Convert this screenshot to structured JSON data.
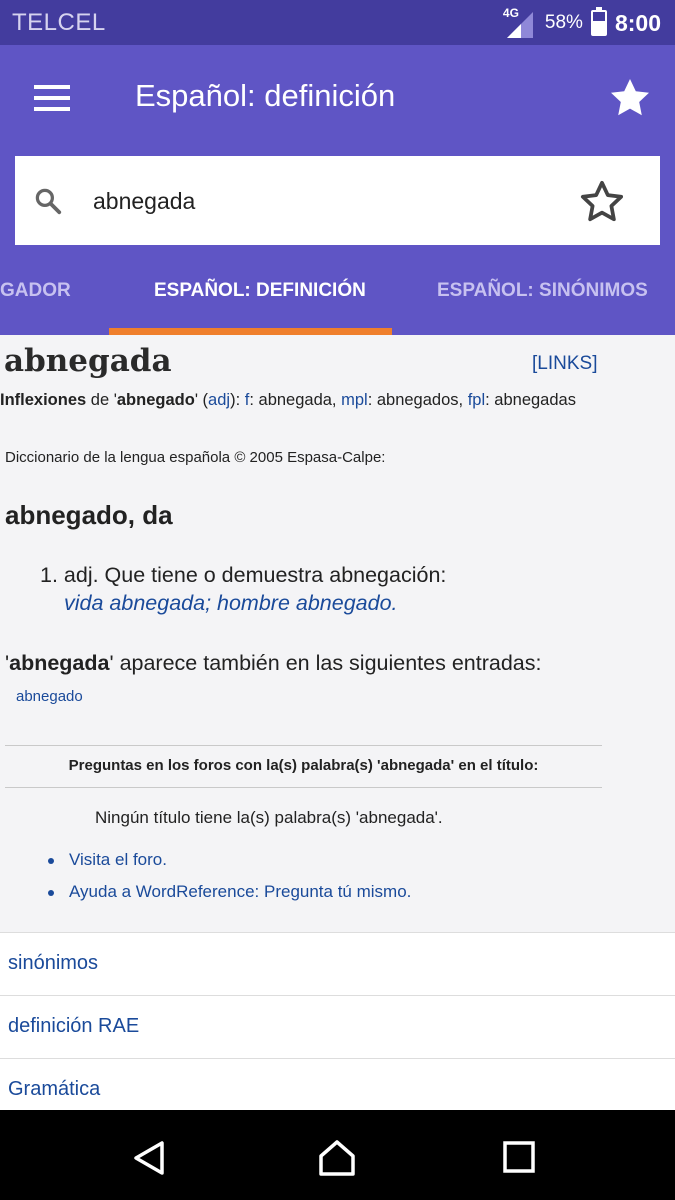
{
  "status_bar": {
    "carrier": "TELCEL",
    "network": "4G",
    "battery_percent": "58%",
    "battery_level": 0.58,
    "time": "8:00"
  },
  "app_bar": {
    "title": "Español: definición",
    "menu_icon": "hamburger-menu-icon",
    "favorite_icon": "star-filled-icon"
  },
  "search": {
    "value": "abnegada",
    "icon": "search-icon",
    "bookmark_icon": "star-outline-icon"
  },
  "tabs": {
    "items": [
      {
        "label": "GADOR"
      },
      {
        "label": "ESPAÑOL: DEFINICIÓN"
      },
      {
        "label": "ESPAÑOL: SINÓNIMOS"
      }
    ],
    "active_index": 1
  },
  "entry": {
    "headword": "abnegada",
    "links_label": "[LINKS]",
    "inflections": {
      "label": "Inflexiones",
      "de": " de '",
      "word": "abnegado",
      "close": "' (",
      "pos": "adj",
      "close2": "): ",
      "f_label": "f",
      "f_value": ": abnegada, ",
      "mpl_label": "mpl",
      "mpl_value": ": abnegados, ",
      "fpl_label": "fpl",
      "fpl_value": ": abnegadas"
    },
    "dictionary_source": "Diccionario de la lengua española © 2005 Espasa-Calpe:",
    "entry_heading": "abnegado, da",
    "sense": "1. adj. Que tiene o demuestra abnegación:",
    "example": "vida abnegada; hombre abnegado.",
    "also_appears": {
      "quote_open": "'",
      "word": "abnegada",
      "rest": "' aparece también en las siguientes entradas:"
    },
    "also_link": "abnegado"
  },
  "forum": {
    "heading": "Preguntas en los foros con la(s) palabra(s) 'abnegada' en el título:",
    "no_result": "Ningún título tiene la(s) palabra(s) 'abnegada'.",
    "links": [
      "Visita el foro.",
      "Ayuda a WordReference: Pregunta tú mismo."
    ]
  },
  "more_links": [
    "sinónimos",
    "definición RAE",
    "Gramática"
  ],
  "colors": {
    "status_bar": "#433c9e",
    "app_bar": "#5f55c5",
    "tab_indicator": "#ef7f2c",
    "link": "#1a4a9a"
  },
  "nav_bar": {
    "back_icon": "back-triangle-icon",
    "home_icon": "home-icon",
    "recents_icon": "recents-square-icon"
  }
}
